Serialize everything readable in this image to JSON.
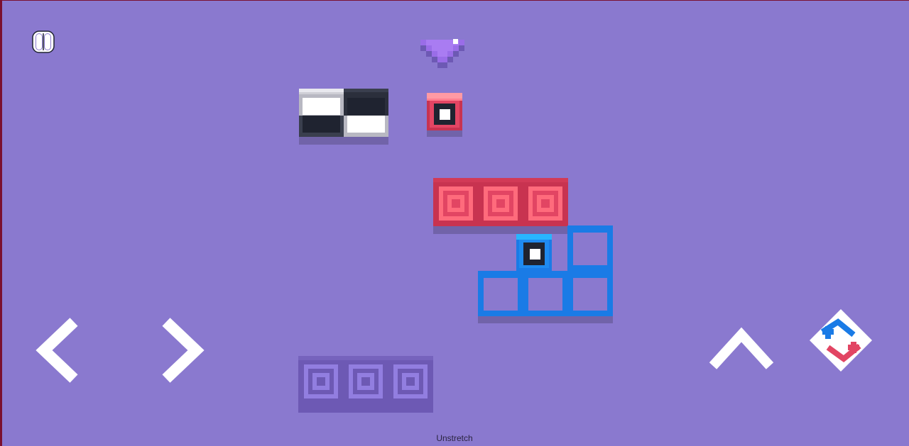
{
  "colors": {
    "background": "#8a79cf",
    "edge": "#7a1030",
    "red": "#e24563",
    "red_light": "#ff7f90",
    "red_dark": "#c83350",
    "blue": "#1a7be6",
    "blue_light": "#28b6ff",
    "dark": "#1f2330",
    "purple_dark": "#6d59b4",
    "purple_mid": "#927ee0",
    "white": "#ffffff"
  },
  "icons": {
    "pause": "pause-icon",
    "goal": "heart-gem-icon",
    "left": "chevron-left-icon",
    "right": "chevron-right-icon",
    "up": "chevron-up-icon",
    "swap": "swap-characters-icon"
  },
  "footer": {
    "label": "Unstretch"
  }
}
